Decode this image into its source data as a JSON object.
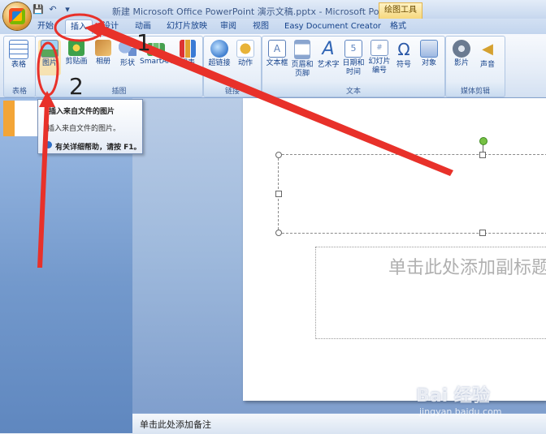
{
  "window": {
    "title": "新建 Microsoft Office PowerPoint 演示文稿.pptx - Microsoft PowerPoint",
    "tool_context": "绘图工具"
  },
  "quick_access": {
    "save": "💾",
    "undo": "↶",
    "more": "▾"
  },
  "tabs": [
    {
      "label": "开始"
    },
    {
      "label": "插入",
      "active": true
    },
    {
      "label": "设计"
    },
    {
      "label": "动画"
    },
    {
      "label": "幻灯片放映"
    },
    {
      "label": "审阅"
    },
    {
      "label": "视图"
    },
    {
      "label": "Easy Document Creator"
    },
    {
      "label": "格式"
    }
  ],
  "ribbon": {
    "groups": [
      {
        "label": "表格"
      },
      {
        "label": "插图"
      },
      {
        "label": "链接"
      },
      {
        "label": "文本"
      },
      {
        "label": "媒体剪辑"
      }
    ],
    "buttons": [
      {
        "label": "表格",
        "icon": "table-icon",
        "color": "#4f7fc8"
      },
      {
        "label": "图片",
        "icon": "picture-icon",
        "color": "#5aa0d8"
      },
      {
        "label": "剪贴画",
        "icon": "clipart-icon",
        "color": "#3ea14a"
      },
      {
        "label": "相册",
        "icon": "album-icon",
        "color": "#c9873a"
      },
      {
        "label": "形状",
        "icon": "shapes-icon",
        "color": "#6b8fd0"
      },
      {
        "label": "SmartArt",
        "icon": "smartart-icon",
        "color": "#46a04f"
      },
      {
        "label": "图表",
        "icon": "chart-icon",
        "color": "#e0a030"
      },
      {
        "label": "超链接",
        "icon": "hyperlink-icon",
        "color": "#3f7ecf"
      },
      {
        "label": "动作",
        "icon": "action-icon",
        "color": "#e8b338"
      },
      {
        "label": "文本框",
        "icon": "textbox-icon",
        "color": "#5b7fb8"
      },
      {
        "label": "页眉和页脚",
        "icon": "header-footer-icon",
        "color": "#8aa5cf"
      },
      {
        "label": "艺术字",
        "icon": "wordart-icon",
        "color": "#3065b5"
      },
      {
        "label": "日期和时间",
        "icon": "datetime-icon",
        "color": "#5f86c1"
      },
      {
        "label": "幻灯片编号",
        "icon": "slide-number-icon",
        "color": "#7796c6"
      },
      {
        "label": "符号",
        "icon": "symbol-icon",
        "color": "#2c5aa8"
      },
      {
        "label": "对象",
        "icon": "object-icon",
        "color": "#5d8ac9"
      },
      {
        "label": "影片",
        "icon": "movie-icon",
        "color": "#6b7b91"
      },
      {
        "label": "声音",
        "icon": "sound-icon",
        "color": "#d5a130"
      }
    ]
  },
  "tooltip": {
    "title": "插入来自文件的图片",
    "description": "插入来自文件的图片。",
    "help": "有关详细帮助，请按 F1。"
  },
  "slide": {
    "subtitle_placeholder": "单击此处添加副标题"
  },
  "notes": {
    "placeholder": "单击此处添加备注"
  },
  "annotations": {
    "step1": "1",
    "step2": "2",
    "arrow_color": "#e8312a"
  },
  "watermark": {
    "logo": "Bai 经验",
    "url": "jingyan.baidu.com"
  }
}
